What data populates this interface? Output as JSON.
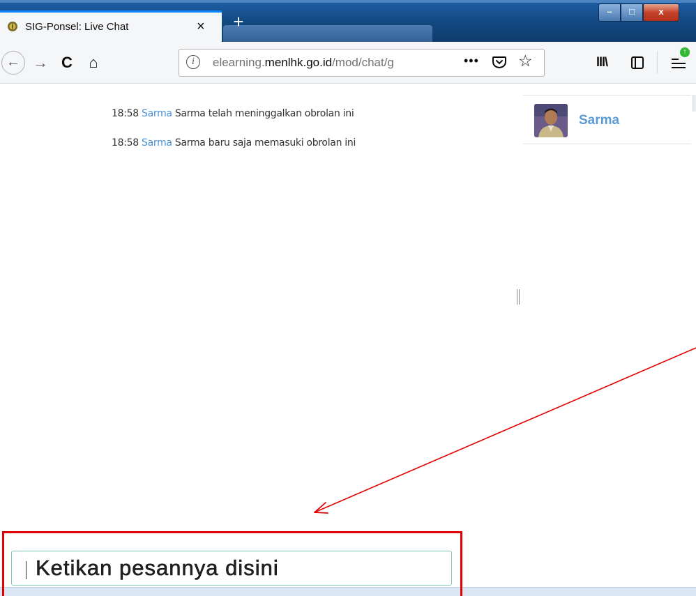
{
  "browser": {
    "tab_title": "SIG-Ponsel: Live Chat",
    "tab_close": "×",
    "new_tab": "+",
    "window_controls": {
      "minimize": "–",
      "maximize": "□",
      "close": "x"
    },
    "nav": {
      "back": "←",
      "forward": "→",
      "reload": "C",
      "home": "⌂"
    },
    "url": {
      "prefix": "elearning.",
      "domain": "menlhk.go.id",
      "path": "/mod/chat/g"
    },
    "url_actions": {
      "more": "•••",
      "bookmark": "☆"
    },
    "toolbar": {
      "library": "lll\\",
      "update_badge": "↑"
    },
    "icons": [
      "tab-favicon-icon",
      "back-icon",
      "forward-icon",
      "reload-icon",
      "home-icon",
      "info-icon",
      "page-actions-icon",
      "pocket-icon",
      "bookmark-star-icon",
      "library-icon",
      "sidebar-icon",
      "menu-icon"
    ]
  },
  "chat": {
    "messages": [
      {
        "time": "18:58",
        "user": "Sarma",
        "text": "Sarma telah meninggalkan obrolan ini"
      },
      {
        "time": "18:58",
        "user": "Sarma",
        "text": "Sarma baru saja memasuki obrolan ini"
      }
    ],
    "users": [
      {
        "name": "Sarma"
      }
    ],
    "input": {
      "value": "Ketikan pesannya disini"
    }
  },
  "colors": {
    "user_link": "#4a90d9",
    "annotation": "#e30000",
    "titlebar": "#12487f",
    "input_border": "#7dc9a9"
  }
}
